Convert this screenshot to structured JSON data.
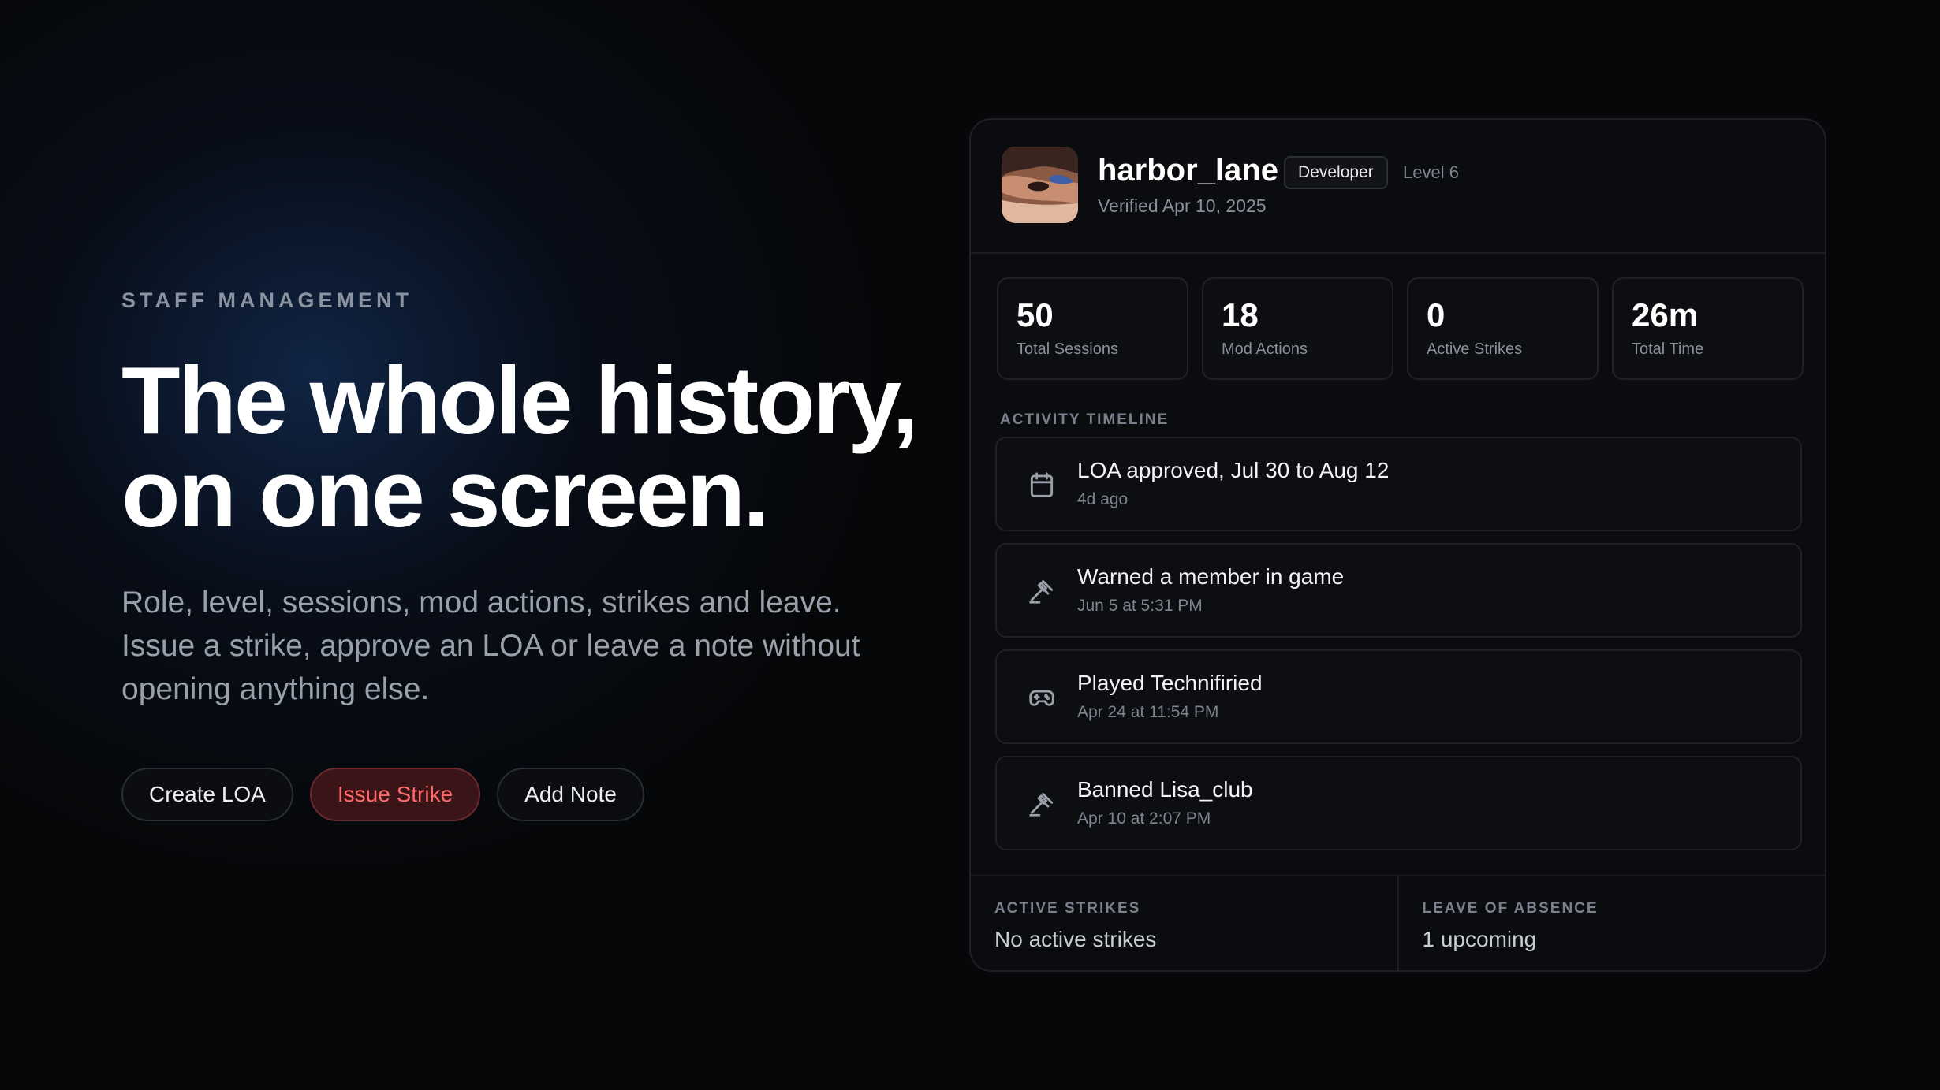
{
  "hero": {
    "eyebrow": "STAFF MANAGEMENT",
    "headline_line1": "The whole history,",
    "headline_line2": "on one screen.",
    "subcopy": "Role, level, sessions, mod actions, strikes and leave. Issue a strike, approve an LOA or leave a note without opening anything else.",
    "actions": {
      "create_loa": "Create LOA",
      "issue_strike": "Issue Strike",
      "add_note": "Add Note"
    }
  },
  "profile": {
    "username": "harbor_lane",
    "role": "Developer",
    "level": "Level 6",
    "verified": "Verified Apr 10, 2025"
  },
  "stats": [
    {
      "value": "50",
      "label": "Total Sessions"
    },
    {
      "value": "18",
      "label": "Mod Actions"
    },
    {
      "value": "0",
      "label": "Active Strikes"
    },
    {
      "value": "26m",
      "label": "Total Time"
    }
  ],
  "timeline": {
    "label": "ACTIVITY TIMELINE",
    "items": [
      {
        "icon": "calendar-icon",
        "title": "LOA approved, Jul 30 to Aug 12",
        "time": "4d ago"
      },
      {
        "icon": "gavel-icon",
        "title": "Warned a member in game",
        "time": "Jun 5 at 5:31 PM"
      },
      {
        "icon": "gamepad-icon",
        "title": "Played Technifiried",
        "time": "Apr 24 at 11:54 PM"
      },
      {
        "icon": "gavel-icon",
        "title": "Banned Lisa_club",
        "time": "Apr 10 at 2:07 PM"
      }
    ]
  },
  "footer": {
    "strikes_label": "ACTIVE STRIKES",
    "strikes_value": "No active strikes",
    "loa_label": "LEAVE OF ABSENCE",
    "loa_value": "1 upcoming"
  },
  "colors": {
    "background": "#060709",
    "card": "#0b0c0f",
    "danger": "#ff6b6b",
    "danger_bg": "#3b1418"
  }
}
